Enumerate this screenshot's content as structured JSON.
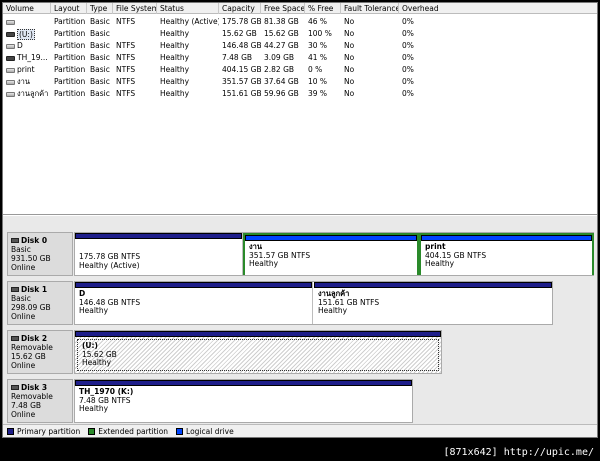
{
  "table": {
    "headers": [
      "Volume",
      "Layout",
      "Type",
      "File System",
      "Status",
      "Capacity",
      "Free Space",
      "% Free",
      "Fault Tolerance",
      "Overhead"
    ],
    "rows": [
      {
        "volume": "",
        "icon": "drive-icon",
        "layout": "Partition",
        "type": "Basic",
        "fs": "NTFS",
        "status": "Healthy (Active)",
        "capacity": "175.78 GB",
        "free": "81.38 GB",
        "pct": "46 %",
        "fault": "No",
        "overhead": "0%"
      },
      {
        "volume": "(U:)",
        "icon": "removable-drive-icon",
        "layout": "Partition",
        "type": "Basic",
        "fs": "",
        "status": "Healthy",
        "capacity": "15.62 GB",
        "free": "15.62 GB",
        "pct": "100 %",
        "fault": "No",
        "overhead": "0%"
      },
      {
        "volume": "D",
        "icon": "drive-icon",
        "layout": "Partition",
        "type": "Basic",
        "fs": "NTFS",
        "status": "Healthy",
        "capacity": "146.48 GB",
        "free": "44.27 GB",
        "pct": "30 %",
        "fault": "No",
        "overhead": "0%"
      },
      {
        "volume": "TH_19...",
        "icon": "removable-drive-icon",
        "layout": "Partition",
        "type": "Basic",
        "fs": "NTFS",
        "status": "Healthy",
        "capacity": "7.48 GB",
        "free": "3.09 GB",
        "pct": "41 %",
        "fault": "No",
        "overhead": "0%"
      },
      {
        "volume": "print",
        "icon": "drive-icon",
        "layout": "Partition",
        "type": "Basic",
        "fs": "NTFS",
        "status": "Healthy",
        "capacity": "404.15 GB",
        "free": "2.82 GB",
        "pct": "0 %",
        "fault": "No",
        "overhead": "0%"
      },
      {
        "volume": "งาน",
        "icon": "drive-icon",
        "layout": "Partition",
        "type": "Basic",
        "fs": "NTFS",
        "status": "Healthy",
        "capacity": "351.57 GB",
        "free": "37.64 GB",
        "pct": "10 %",
        "fault": "No",
        "overhead": "0%"
      },
      {
        "volume": "งานลูกค้า",
        "icon": "drive-icon",
        "layout": "Partition",
        "type": "Basic",
        "fs": "NTFS",
        "status": "Healthy",
        "capacity": "151.61 GB",
        "free": "59.96 GB",
        "pct": "39 %",
        "fault": "No",
        "overhead": "0%"
      }
    ]
  },
  "disks": [
    {
      "name": "Disk 0",
      "type": "Basic",
      "size": "931.50 GB",
      "state": "Online",
      "partitions": [
        {
          "name": "",
          "size": "175.78 GB NTFS",
          "status": "Healthy (Active)",
          "kind": "primary"
        },
        {
          "name": "งาน",
          "size": "351.57 GB NTFS",
          "status": "Healthy",
          "kind": "logical"
        },
        {
          "name": "print",
          "size": "404.15 GB NTFS",
          "status": "Healthy",
          "kind": "logical"
        }
      ]
    },
    {
      "name": "Disk 1",
      "type": "Basic",
      "size": "298.09 GB",
      "state": "Online",
      "partitions": [
        {
          "name": "D",
          "size": "146.48 GB NTFS",
          "status": "Healthy",
          "kind": "primary"
        },
        {
          "name": "งานลูกค้า",
          "size": "151.61 GB NTFS",
          "status": "Healthy",
          "kind": "primary"
        }
      ]
    },
    {
      "name": "Disk 2",
      "type": "Removable",
      "size": "15.62 GB",
      "state": "Online",
      "partitions": [
        {
          "name": "(U:)",
          "size": "15.62 GB",
          "status": "Healthy",
          "kind": "primary"
        }
      ]
    },
    {
      "name": "Disk 3",
      "type": "Removable",
      "size": "7.48 GB",
      "state": "Online",
      "partitions": [
        {
          "name": "TH_1970  (K:)",
          "size": "7.48 GB NTFS",
          "status": "Healthy",
          "kind": "primary"
        }
      ]
    }
  ],
  "legend": [
    {
      "label": "Primary partition",
      "color": "#1e1e8a"
    },
    {
      "label": "Extended partition",
      "color": "#2a8a2a"
    },
    {
      "label": "Logical drive",
      "color": "#0044ff"
    }
  ],
  "watermark": "[871x642] http://upic.me/"
}
